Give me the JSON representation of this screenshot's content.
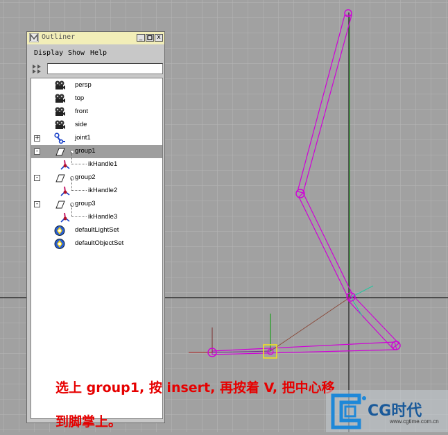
{
  "outliner": {
    "title": "Outliner",
    "menu": [
      "Display",
      "Show",
      "Help"
    ],
    "controls": {
      "minimize": "_",
      "close": "x"
    },
    "filter_value": "",
    "items": [
      {
        "label": "persp",
        "icon": "camera-icon"
      },
      {
        "label": "top",
        "icon": "camera-icon"
      },
      {
        "label": "front",
        "icon": "camera-icon"
      },
      {
        "label": "side",
        "icon": "camera-icon"
      },
      {
        "label": "joint1",
        "icon": "joint-icon",
        "expander": "+"
      },
      {
        "label": "group1",
        "icon": "group-icon",
        "expander": "-",
        "selected": true
      },
      {
        "label": "ikHandle1",
        "icon": "ik-handle-icon",
        "child": true
      },
      {
        "label": "group2",
        "icon": "group-icon",
        "expander": "-"
      },
      {
        "label": "ikHandle2",
        "icon": "ik-handle-icon",
        "child": true
      },
      {
        "label": "group3",
        "icon": "group-icon",
        "expander": "-"
      },
      {
        "label": "ikHandle3",
        "icon": "ik-handle-icon",
        "child": true
      },
      {
        "label": "defaultLightSet",
        "icon": "set-icon"
      },
      {
        "label": "defaultObjectSet",
        "icon": "set-icon"
      }
    ]
  },
  "caption": {
    "line1": "选上 group1, 按 insert, 再按着 V, 把中心移",
    "line2": "到脚掌上。"
  },
  "watermark": {
    "brand": "CG时代",
    "url": "www.cgtime.com.cn"
  },
  "colors": {
    "viewport_bg": "#a1a1a1",
    "grid": "#b6b6b6",
    "bone": "#d000d8",
    "titlebar": "#f2eeb8",
    "selection": "#9e9e9e",
    "caption": "#e60000",
    "logo_blue": "#1e88d8"
  }
}
